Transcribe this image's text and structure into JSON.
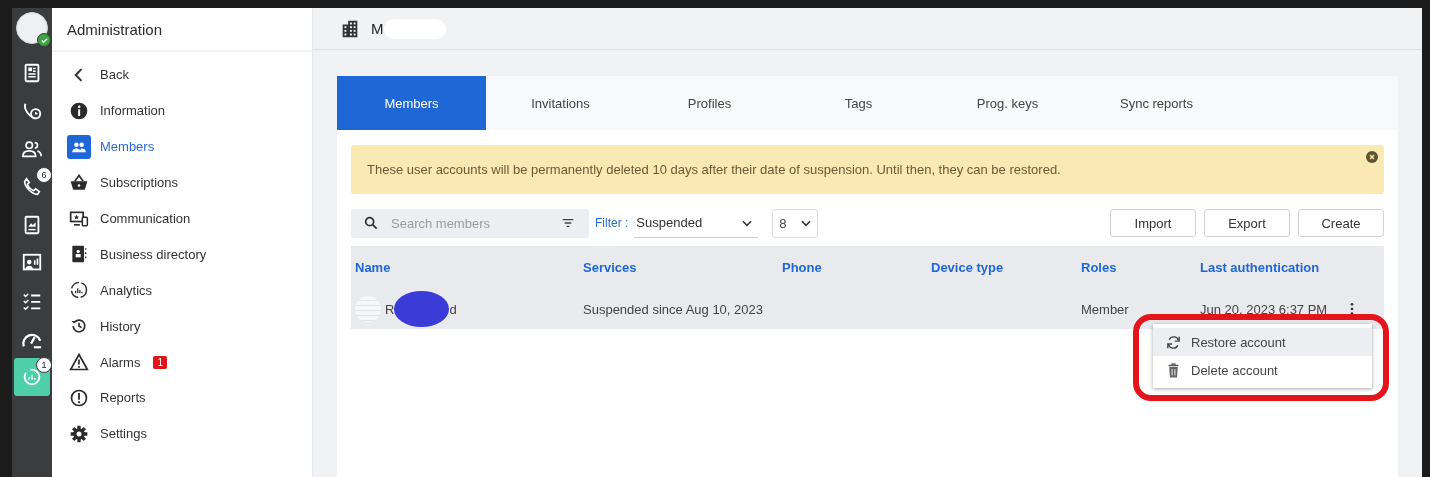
{
  "rail": {
    "avatar_online": true,
    "items": [
      {
        "selected": false
      },
      {
        "selected": false
      },
      {
        "selected": false
      },
      {
        "badge": "6",
        "selected": false
      },
      {
        "selected": false
      },
      {
        "selected": false
      },
      {
        "selected": false
      },
      {
        "selected": false
      },
      {
        "badge": "1",
        "selected": true
      }
    ]
  },
  "sidebar": {
    "title": "Administration",
    "items": [
      {
        "label": "Back",
        "kind": "back",
        "selected": false
      },
      {
        "label": "Information",
        "kind": "item",
        "selected": false
      },
      {
        "label": "Members",
        "kind": "item",
        "selected": true
      },
      {
        "label": "Subscriptions",
        "kind": "item",
        "selected": false
      },
      {
        "label": "Communication",
        "kind": "item",
        "selected": false
      },
      {
        "label": "Business directory",
        "kind": "item",
        "selected": false
      },
      {
        "label": "Analytics",
        "kind": "item",
        "selected": false
      },
      {
        "label": "History",
        "kind": "item",
        "selected": false
      },
      {
        "label": "Alarms",
        "kind": "item",
        "selected": false,
        "badge": "1"
      },
      {
        "label": "Reports",
        "kind": "item",
        "selected": false
      },
      {
        "label": "Settings",
        "kind": "item",
        "selected": false
      }
    ]
  },
  "header": {
    "title": "M"
  },
  "tabs": [
    {
      "label": "Members",
      "selected": true
    },
    {
      "label": "Invitations",
      "selected": false
    },
    {
      "label": "Profiles",
      "selected": false
    },
    {
      "label": "Tags",
      "selected": false
    },
    {
      "label": "Prog. keys",
      "selected": false
    },
    {
      "label": "Sync reports",
      "selected": false
    }
  ],
  "notice": {
    "text": "These user accounts will be permanently deleted 10 days after their date of suspension. Until then, they can be restored."
  },
  "toolbar": {
    "search": {
      "placeholder": "Search members"
    },
    "filter_label": "Filter :",
    "filter_value": "Suspended",
    "page_size": "8",
    "buttons": [
      "Import",
      "Export",
      "Create"
    ]
  },
  "table": {
    "columns": [
      "Name",
      "Services",
      "Phone",
      "Device type",
      "Roles",
      "Last authentication"
    ],
    "rows": [
      {
        "name_start": "R",
        "name_end": "d",
        "services": "Suspended since Aug 10, 2023",
        "roles": "Member",
        "last_authentication": "Jun 20, 2023 6:37 PM"
      }
    ]
  },
  "row_menu": {
    "highlighted": true,
    "items": [
      {
        "label": "Restore account",
        "kind": "restore",
        "selected": true
      },
      {
        "label": "Delete account",
        "kind": "delete",
        "selected": false
      }
    ]
  }
}
